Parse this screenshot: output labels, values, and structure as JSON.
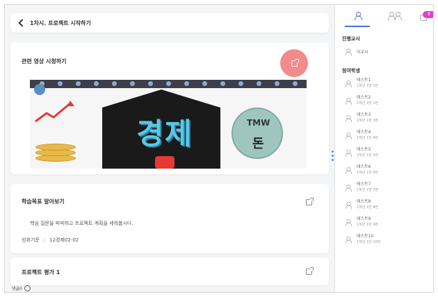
{
  "header": {
    "title": "1차시. 프로젝트 시작하기"
  },
  "video_card": {
    "title": "관련 영상 시청하기",
    "thumbnail_sign": "경제",
    "thumbnail_badge": "TMW",
    "thumbnail_badge_sub": "돈"
  },
  "goal_card": {
    "title": "학습목표 알아보기",
    "body": "핵심 질문을 파악하고 프로젝트 계획을 세워봅시다.",
    "criteria_label": "성취기준",
    "criteria_code": "12경제02-02"
  },
  "project_card": {
    "title": "프로젝트 평가 1"
  },
  "comments": {
    "label": "댓글0"
  },
  "sidebar": {
    "message_count": "9",
    "teacher_section": "진행교사",
    "teacher_name": "이교사",
    "student_section": "참여학생",
    "students": [
      {
        "name": "테스트1",
        "sub": "1학년 1반 1번"
      },
      {
        "name": "테스트2",
        "sub": "1학년 1반 2번"
      },
      {
        "name": "테스트3",
        "sub": "1학년 1반 3번"
      },
      {
        "name": "테스트4",
        "sub": "1학년 1반 4번"
      },
      {
        "name": "테스트5",
        "sub": "1학년 1반 5번"
      },
      {
        "name": "테스트6",
        "sub": "1학년 1반 6번"
      },
      {
        "name": "테스트7",
        "sub": "1학년 1반 7번"
      },
      {
        "name": "테스트8",
        "sub": "1학년 1반 8번"
      },
      {
        "name": "테스트9",
        "sub": "1학년 1반 9번"
      },
      {
        "name": "테스트10",
        "sub": "1학년 1반 10번"
      }
    ]
  },
  "colors": {
    "accent": "#4a6fd6",
    "fab": "#f28b8b",
    "badge": "#e23cd1"
  }
}
